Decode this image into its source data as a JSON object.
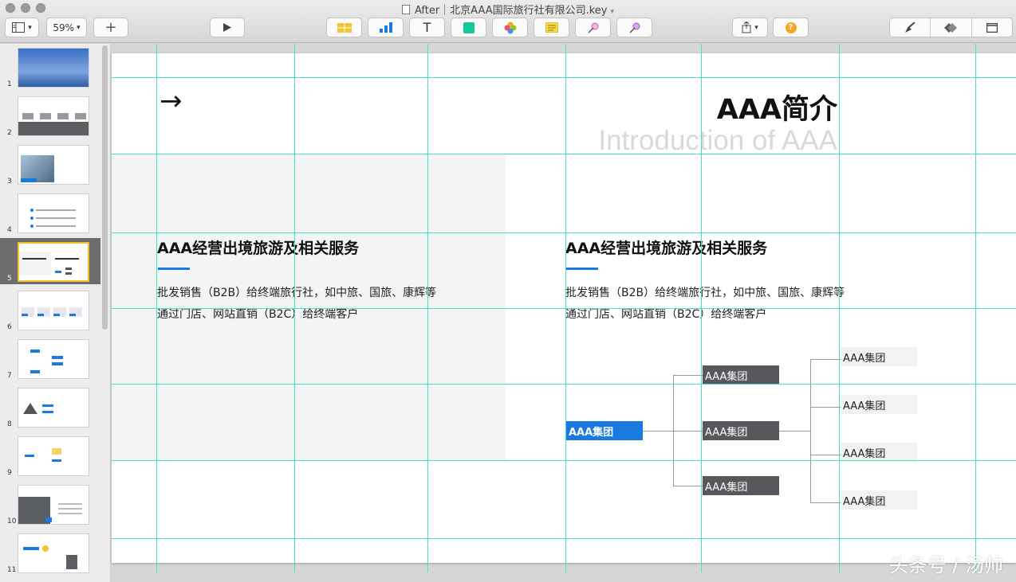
{
  "window": {
    "title": "After｜北京AAA国际旅行社有限公司.key",
    "colors": {
      "guide": "#46e0cc",
      "accent": "#1a7ae0",
      "selection": "#f2c12e",
      "node_dark": "#56585c"
    }
  },
  "toolbar": {
    "view_icon": "sidebar-view-icon",
    "zoom": "59%",
    "add_icon": "plus-icon",
    "play_icon": "play-icon",
    "insert_items": [
      "table-icon",
      "chart-icon",
      "text-icon",
      "shape-icon",
      "media-icon",
      "comment-icon",
      "pen-icon",
      "animate-icon"
    ],
    "share_icon": "share-icon",
    "tips_label": "?",
    "inspector_items": [
      "format-icon",
      "animate-panel-icon",
      "document-icon"
    ]
  },
  "sidebar": {
    "slides": [
      {
        "number": "1"
      },
      {
        "number": "2"
      },
      {
        "number": "3"
      },
      {
        "number": "4"
      },
      {
        "number": "5"
      },
      {
        "number": "6"
      },
      {
        "number": "7"
      },
      {
        "number": "8"
      },
      {
        "number": "9"
      },
      {
        "number": "10"
      },
      {
        "number": "11"
      }
    ],
    "selected_index": 5
  },
  "slide": {
    "arrow": "→",
    "title": "AAA简介",
    "subtitle": "Introduction of AAA",
    "left": {
      "heading": "AAA经营出境旅游及相关服务",
      "line1": "批发销售（B2B）给终端旅行社，如中旅、国旅、康辉等",
      "line2": "通过门店、网站直销（B2C）给终端客户"
    },
    "right": {
      "heading": "AAA经营出境旅游及相关服务",
      "line1": "批发销售（B2B）给终端旅行社，如中旅、国旅、康辉等",
      "line2": "通过门店、网站直销（B2C）给终端客户"
    },
    "org": {
      "root": "AAA集团",
      "mid": [
        "AAA集团",
        "AAA集团",
        "AAA集团"
      ],
      "leaves": [
        "AAA集团",
        "AAA集团",
        "AAA集团",
        "AAA集团"
      ]
    }
  },
  "watermark": "头条号 / 汤帅"
}
